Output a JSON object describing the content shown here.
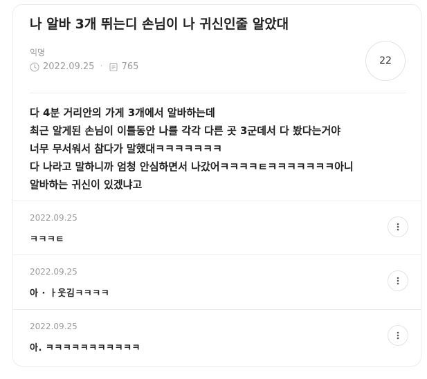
{
  "post": {
    "title": "나 알바 3개 뛰는디 손님이 나 귀신인줄 알았대",
    "author": "익명",
    "date": "2022.09.25",
    "views": "765",
    "comment_count": "22",
    "body": [
      "다 4분 거리안의 가게 3개에서 알바하는데",
      "최근 알게된 손님이 이틀동안 나를 각각 다른 곳 3군데서 다 봤다는거야",
      "너무 무서워서 참다가 말했대ㅋㅋㅋㅋㅋㅋㅋ",
      "다 나라고 말하니까 엄청 안심하면서 나갔어ㅋㅋㅋㅋㅌㅋㅋㅋㅋㅋㅋㅋ아니",
      "알바하는 귀신이 있겠냐고"
    ]
  },
  "comments": [
    {
      "date": "2022.09.25",
      "text": "ㅋㅋㅋㅌ"
    },
    {
      "date": "2022.09.25",
      "text": "아 · ㅏ웃김ㅋㅋㅋㅋ"
    },
    {
      "date": "2022.09.25",
      "text": "아.  ㅋㅋㅋㅋㅋㅋㅋㅋㅋㅋㅋ"
    }
  ],
  "icons": {
    "date": "clock-icon",
    "views": "document-icon",
    "more": "more-vertical-icon"
  }
}
